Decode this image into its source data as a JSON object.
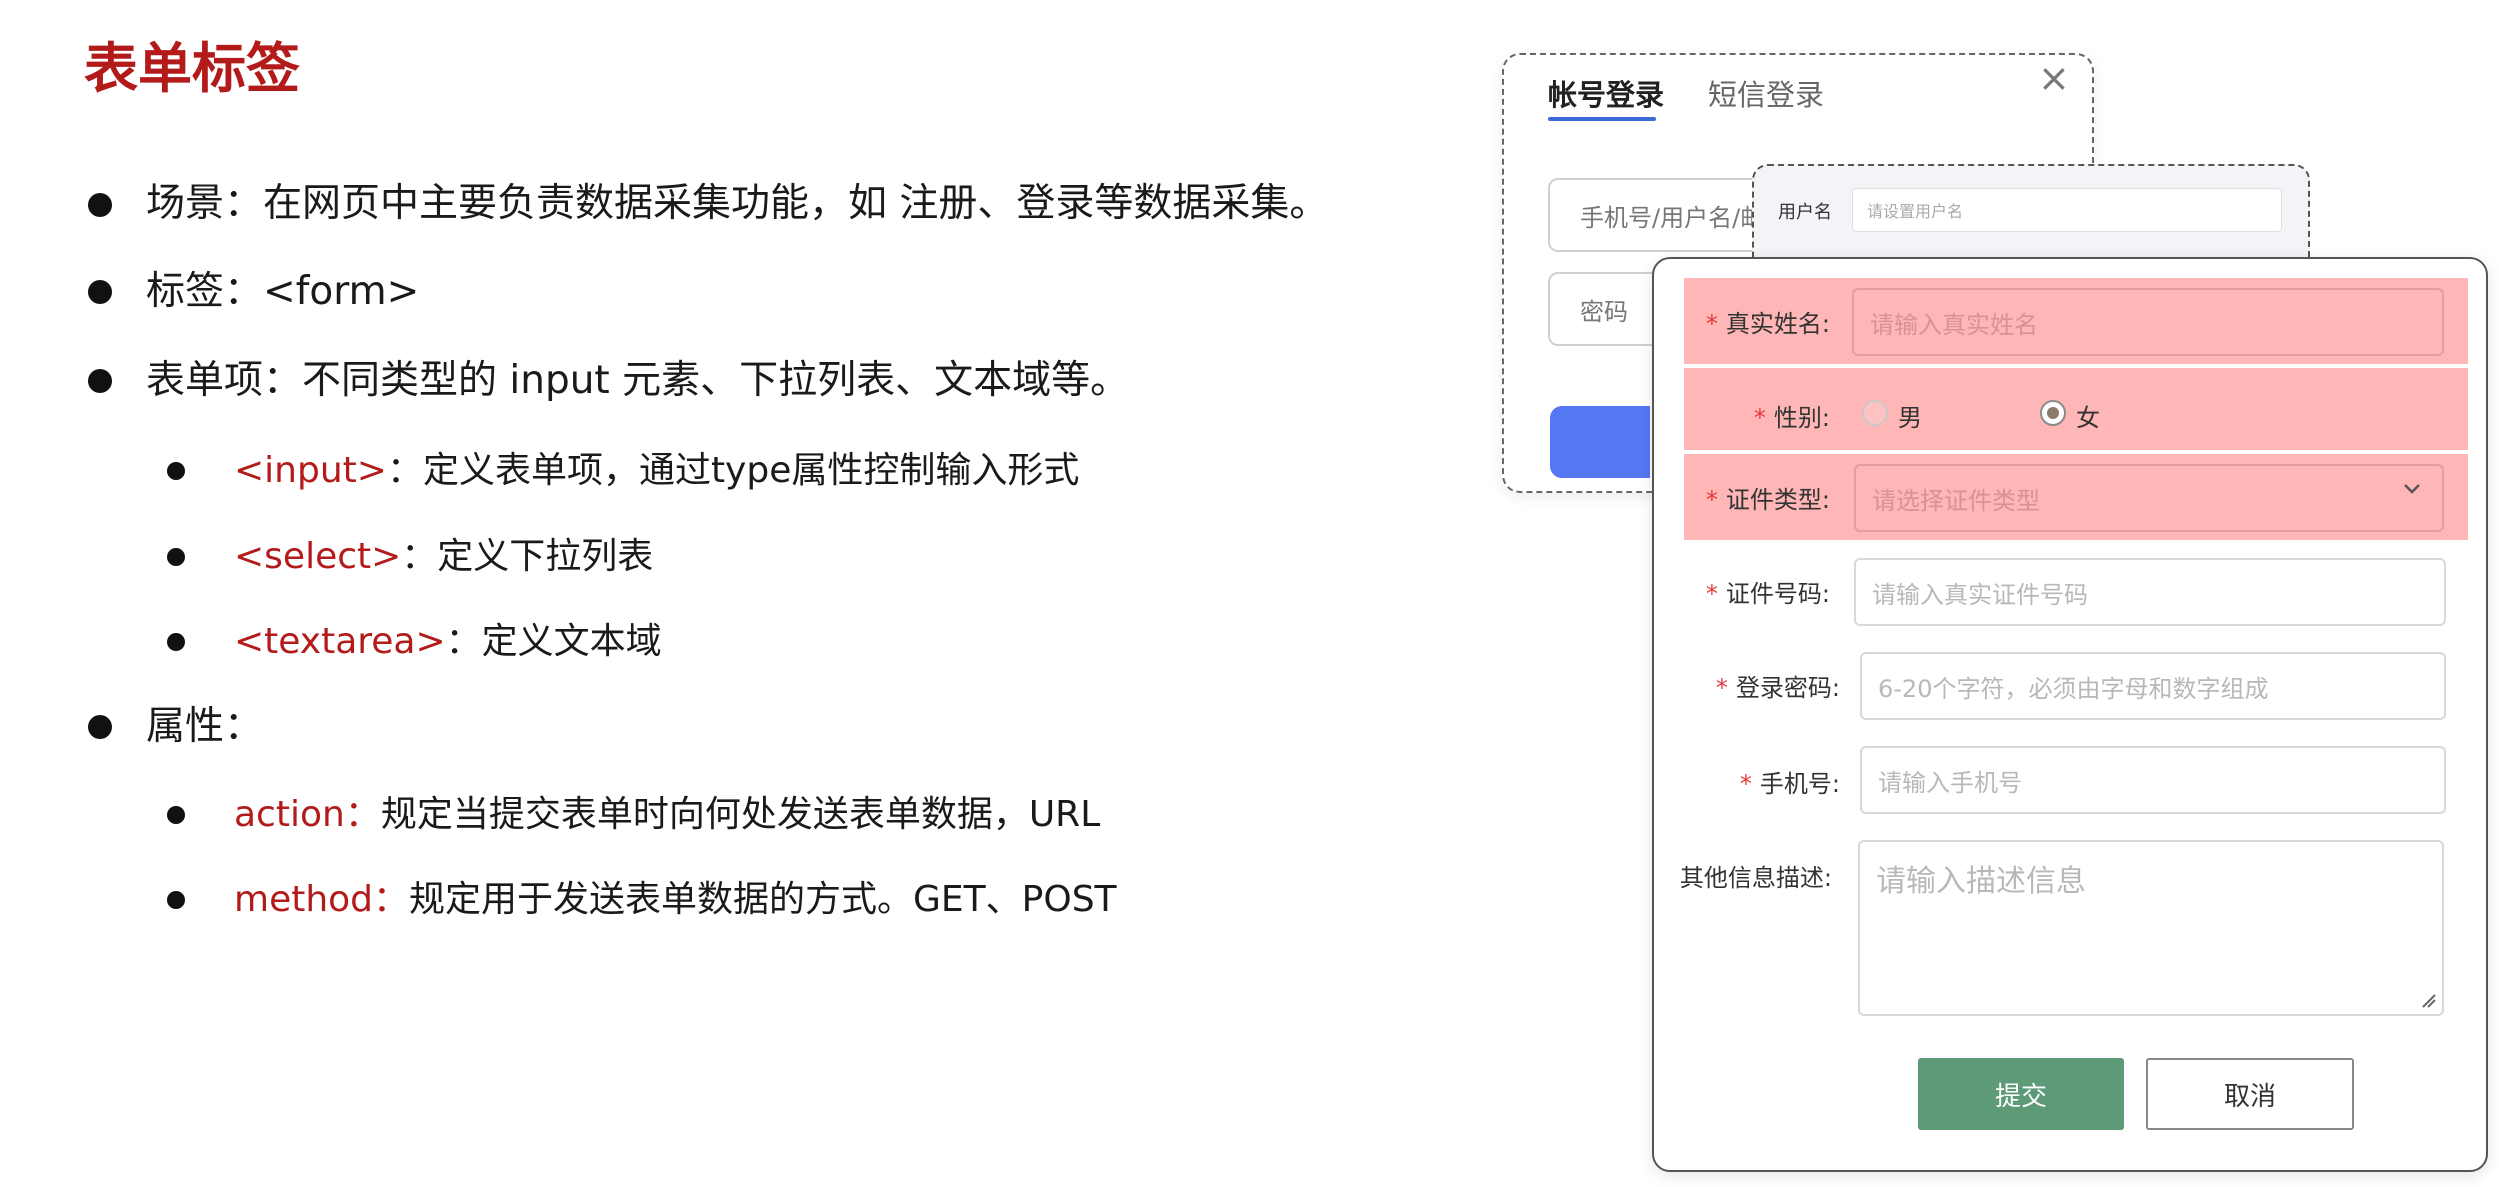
{
  "title": "表单标签",
  "bullets": {
    "scene": "场景：在网页中主要负责数据采集功能，如 注册、登录等数据采集。",
    "tag": "标签：<form>",
    "items": "表单项：不同类型的 input 元素、下拉列表、文本域等。",
    "input_tag": "<input>",
    "input_desc": "：定义表单项，通过type属性控制输入形式",
    "select_tag": "<select>",
    "select_desc": "：定义下拉列表",
    "textarea_tag": "<textarea>",
    "textarea_desc": "：定义文本域",
    "attrs": "属性：",
    "action_name": "action：",
    "action_desc": "规定当提交表单时向何处发送表单数据，URL",
    "method_name": "method：",
    "method_desc": "规定用于发送表单数据的方式。GET、POST"
  },
  "login": {
    "tab_account": "帐号登录",
    "tab_sms": "短信登录",
    "close": "×",
    "username_placeholder": "手机号/用户名/邮",
    "password_placeholder": "密码"
  },
  "mini": {
    "label": "用户名",
    "placeholder": "请设置用户名"
  },
  "form": {
    "name_label": "真实姓名:",
    "name_placeholder": "请输入真实姓名",
    "gender_label": "性别:",
    "gender_male": "男",
    "gender_female": "女",
    "gender_selected": "女",
    "id_type_label": "证件类型:",
    "id_type_placeholder": "请选择证件类型",
    "id_no_label": "证件号码:",
    "id_no_placeholder": "请输入真实证件号码",
    "password_label": "登录密码:",
    "password_placeholder": "6-20个字符，必须由字母和数字组成",
    "phone_label": "手机号:",
    "phone_placeholder": "请输入手机号",
    "desc_label": "其他信息描述:",
    "desc_placeholder": "请输入描述信息",
    "submit": "提交",
    "cancel": "取消",
    "required_mark": "*",
    "highlight_color": "#ffb6b6",
    "submit_color": "#5d9b78"
  }
}
